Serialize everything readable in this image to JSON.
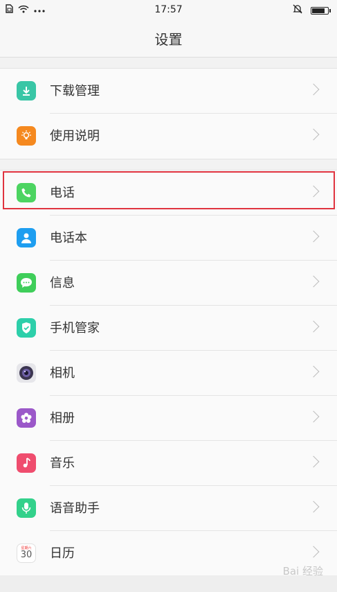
{
  "status_bar": {
    "time": "17:57",
    "icons": [
      "sim-icon",
      "wifi-icon",
      "more-dots-icon",
      "bell-muted-icon",
      "battery-icon"
    ],
    "battery_level": 0.85
  },
  "header": {
    "title": "设置"
  },
  "groups": [
    {
      "items": [
        {
          "label": "下载管理",
          "icon": "download-icon",
          "color": "#39c6a6"
        },
        {
          "label": "使用说明",
          "icon": "bulb-icon",
          "color": "#f5891f"
        }
      ]
    },
    {
      "items": [
        {
          "label": "电话",
          "icon": "phone-icon",
          "color": "#4cd461",
          "highlighted": true
        },
        {
          "label": "电话本",
          "icon": "contacts-icon",
          "color": "#1e9ef0"
        },
        {
          "label": "信息",
          "icon": "message-icon",
          "color": "#3fce5a"
        },
        {
          "label": "手机管家",
          "icon": "shield-icon",
          "color": "#2dcfaa"
        },
        {
          "label": "相机",
          "icon": "camera-icon",
          "color": "#6d5fa6"
        },
        {
          "label": "相册",
          "icon": "gallery-icon",
          "color": "#9b58c9"
        },
        {
          "label": "音乐",
          "icon": "music-icon",
          "color": "#ef4d6e"
        },
        {
          "label": "语音助手",
          "icon": "mic-icon",
          "color": "#33d18b"
        },
        {
          "label": "日历",
          "icon": "calendar-icon",
          "color": "#ffffff",
          "calendar_weekday": "星期六",
          "calendar_day": "30"
        }
      ]
    }
  ],
  "highlight_color": "#e0333f",
  "watermark": "Bai 经验"
}
